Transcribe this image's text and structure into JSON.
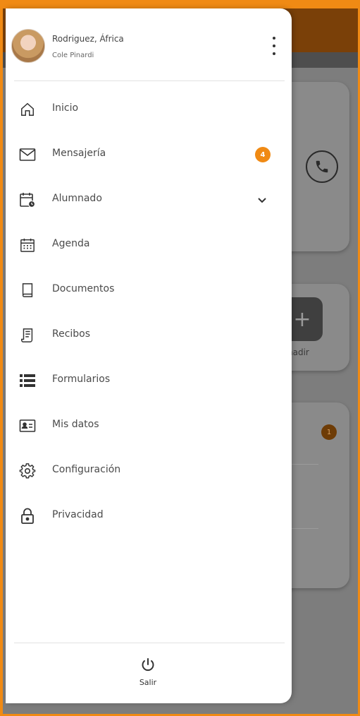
{
  "user": {
    "name": "Rodriguez, África",
    "subtitle": "Cole Pinardi"
  },
  "menu": {
    "items": [
      {
        "label": "Inicio",
        "icon": "home-icon"
      },
      {
        "label": "Mensajería",
        "icon": "mail-icon",
        "badge": "4"
      },
      {
        "label": "Alumnado",
        "icon": "calendar-clock-icon",
        "expandable": true
      },
      {
        "label": "Agenda",
        "icon": "calendar-grid-icon"
      },
      {
        "label": "Documentos",
        "icon": "book-icon"
      },
      {
        "label": "Recibos",
        "icon": "receipt-icon"
      },
      {
        "label": "Formularios",
        "icon": "list-icon"
      },
      {
        "label": "Mis datos",
        "icon": "id-card-icon"
      },
      {
        "label": "Configuración",
        "icon": "gear-icon"
      },
      {
        "label": "Privacidad",
        "icon": "lock-icon"
      }
    ]
  },
  "footer": {
    "logout_label": "Salir"
  },
  "background": {
    "add_label": "ñadir",
    "badge": "1"
  },
  "colors": {
    "accent": "#f08a14",
    "appbar": "#7a4008",
    "scrim": "#7d7d7d"
  }
}
